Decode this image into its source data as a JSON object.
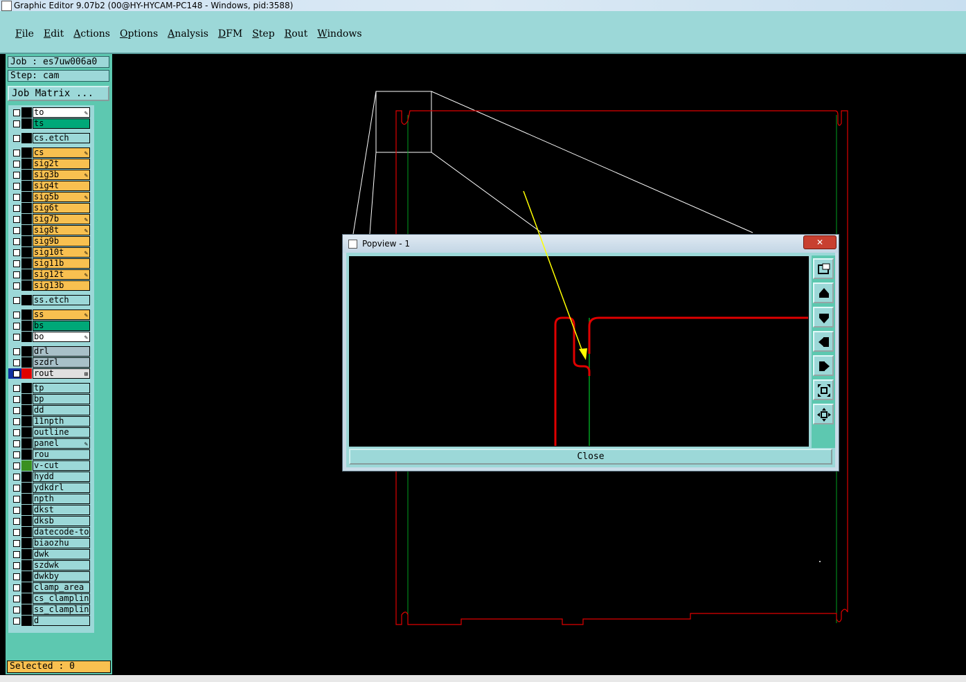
{
  "window": {
    "title": "Graphic Editor 9.07b2 (00@HY-HYCAM-PC148 - Windows, pid:3588)"
  },
  "menu": [
    {
      "label": "File",
      "ul": "F",
      "rest": "ile"
    },
    {
      "label": "Edit",
      "ul": "E",
      "rest": "dit"
    },
    {
      "label": "Actions",
      "ul": "A",
      "rest": "ctions"
    },
    {
      "label": "Options",
      "ul": "O",
      "rest": "ptions"
    },
    {
      "label": "Analysis",
      "ul": "A",
      "rest": "nalysis"
    },
    {
      "label": "DFM",
      "ul": "D",
      "rest": "FM"
    },
    {
      "label": "Step",
      "ul": "S",
      "rest": "tep"
    },
    {
      "label": "Rout",
      "ul": "R",
      "rest": "out"
    },
    {
      "label": "Windows",
      "ul": "W",
      "rest": "indows"
    }
  ],
  "job": {
    "label": "Job : es7uw006a0",
    "step": "Step: cam",
    "matrix_button": "Job Matrix ..."
  },
  "layers": [
    {
      "name": "to",
      "color": "#ffffff",
      "edit": true
    },
    {
      "name": "ts",
      "color": "#00a878",
      "edit": false
    },
    {
      "name": "cs.etch",
      "color": "#9cd8d8",
      "edit": false,
      "gap": true
    },
    {
      "name": "cs",
      "color": "#f8c050",
      "edit": true,
      "gap": true
    },
    {
      "name": "sig2t",
      "color": "#f8c050",
      "edit": false
    },
    {
      "name": "sig3b",
      "color": "#f8c050",
      "edit": true
    },
    {
      "name": "sig4t",
      "color": "#f8c050",
      "edit": false
    },
    {
      "name": "sig5b",
      "color": "#f8c050",
      "edit": true
    },
    {
      "name": "sig6t",
      "color": "#f8c050",
      "edit": false
    },
    {
      "name": "sig7b",
      "color": "#f8c050",
      "edit": true
    },
    {
      "name": "sig8t",
      "color": "#f8c050",
      "edit": true
    },
    {
      "name": "sig9b",
      "color": "#f8c050",
      "edit": false
    },
    {
      "name": "sig10t",
      "color": "#f8c050",
      "edit": true
    },
    {
      "name": "sig11b",
      "color": "#f8c050",
      "edit": false
    },
    {
      "name": "sig12t",
      "color": "#f8c050",
      "edit": true
    },
    {
      "name": "sig13b",
      "color": "#f8c050",
      "edit": false
    },
    {
      "name": "ss.etch",
      "color": "#9cd8d8",
      "edit": false,
      "gap": true
    },
    {
      "name": "ss",
      "color": "#f8c050",
      "edit": true,
      "gap": true
    },
    {
      "name": "bs",
      "color": "#00a878",
      "edit": false
    },
    {
      "name": "bo",
      "color": "#ffffff",
      "edit": true
    },
    {
      "name": "drl",
      "color": "#a8c0c8",
      "edit": false,
      "gap": true
    },
    {
      "name": "szdrl",
      "color": "#a8c0c8",
      "edit": false
    },
    {
      "name": "rout",
      "color": "#e0e0e0",
      "edit": false,
      "active": true
    },
    {
      "name": "tp",
      "color": "#9cd8d8",
      "edit": false,
      "gap": true
    },
    {
      "name": "bp",
      "color": "#9cd8d8",
      "edit": false
    },
    {
      "name": "dd",
      "color": "#9cd8d8",
      "edit": false
    },
    {
      "name": "11npth",
      "color": "#9cd8d8",
      "edit": false
    },
    {
      "name": "outline",
      "color": "#9cd8d8",
      "edit": false
    },
    {
      "name": "panel",
      "color": "#9cd8d8",
      "edit": true
    },
    {
      "name": "rou",
      "color": "#9cd8d8",
      "edit": false
    },
    {
      "name": "v-cut",
      "color": "#9cd8d8",
      "edit": false,
      "green": true
    },
    {
      "name": "hydd",
      "color": "#9cd8d8",
      "edit": false
    },
    {
      "name": "ydkdrl",
      "color": "#9cd8d8",
      "edit": false
    },
    {
      "name": "npth",
      "color": "#9cd8d8",
      "edit": false
    },
    {
      "name": "dkst",
      "color": "#9cd8d8",
      "edit": false
    },
    {
      "name": "dksb",
      "color": "#9cd8d8",
      "edit": false
    },
    {
      "name": "datecode-to",
      "color": "#9cd8d8",
      "edit": false
    },
    {
      "name": "biaozhu",
      "color": "#9cd8d8",
      "edit": false
    },
    {
      "name": "dwk",
      "color": "#9cd8d8",
      "edit": false
    },
    {
      "name": "szdwk",
      "color": "#9cd8d8",
      "edit": false
    },
    {
      "name": "dwkby",
      "color": "#9cd8d8",
      "edit": false
    },
    {
      "name": "clamp_area",
      "color": "#9cd8d8",
      "edit": false
    },
    {
      "name": "cs_clamplin",
      "color": "#9cd8d8",
      "edit": false
    },
    {
      "name": "ss_clamplin",
      "color": "#9cd8d8",
      "edit": false
    },
    {
      "name": "d",
      "color": "#9cd8d8",
      "edit": false
    }
  ],
  "status": {
    "selected": "Selected : 0"
  },
  "popview": {
    "title": "Popview - 1",
    "close_x": "✕",
    "close_button": "Close",
    "tools": [
      "zoom-fit-icon",
      "pan-up-icon",
      "pan-down-icon",
      "pan-left-icon",
      "pan-right-icon",
      "zoom-in-icon",
      "zoom-out-icon"
    ]
  },
  "colors": {
    "rout": "#e00000",
    "profile": "#00a020",
    "annotation": "#ffff00",
    "panel": "#9cd8d8"
  }
}
